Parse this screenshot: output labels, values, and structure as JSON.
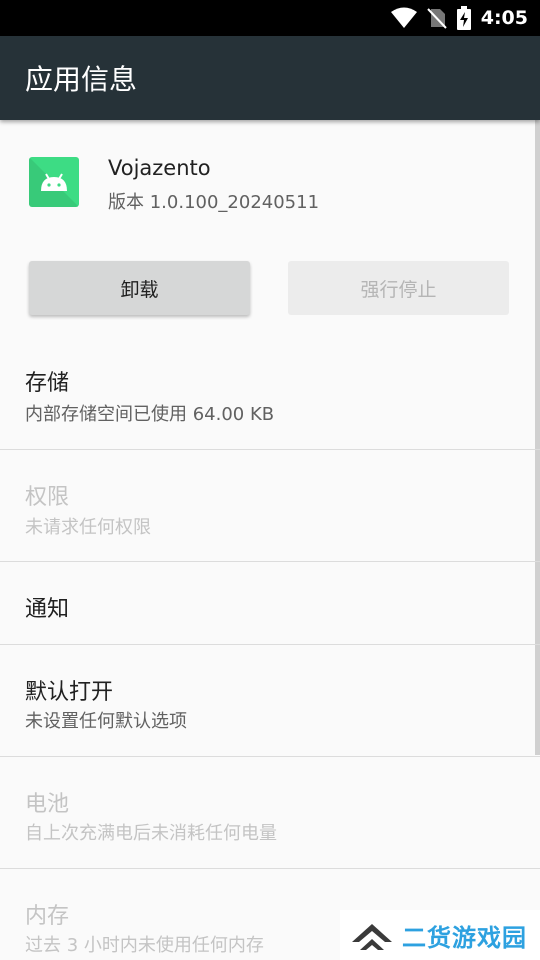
{
  "status_bar": {
    "time": "4:05",
    "icons": [
      "wifi-icon",
      "no-sim-icon",
      "battery-charging-icon"
    ]
  },
  "app_bar": {
    "title": "应用信息"
  },
  "app": {
    "name": "Vojazento",
    "version": "版本 1.0.100_20240511",
    "icon": "android-robot-icon"
  },
  "buttons": {
    "uninstall": "卸载",
    "force_stop": "强行停止"
  },
  "settings": [
    {
      "title": "存储",
      "summary": "内部存储空间已使用 64.00 KB",
      "enabled": true
    },
    {
      "title": "权限",
      "summary": "未请求任何权限",
      "enabled": false
    },
    {
      "title": "通知",
      "summary": "",
      "enabled": true
    },
    {
      "title": "默认打开",
      "summary": "未设置任何默认选项",
      "enabled": true
    },
    {
      "title": "电池",
      "summary": "自上次充满电后未消耗任何电量",
      "enabled": false
    },
    {
      "title": "内存",
      "summary": "过去 3 小时内未使用任何内存",
      "enabled": false
    }
  ],
  "watermark": {
    "text": "二货游戏园"
  },
  "colors": {
    "app_bar": "#263238",
    "status_bar": "#000000",
    "app_icon_bg": "#3ddc84",
    "disabled_text": "#c4c4c4",
    "watermark_text": "#2da1e0"
  }
}
